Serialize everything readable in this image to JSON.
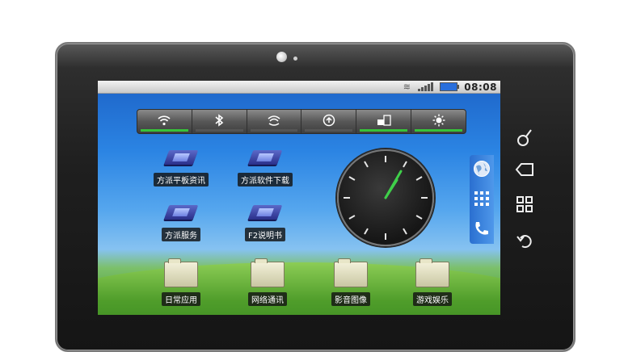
{
  "statusbar": {
    "time": "08:08",
    "wifi_icon": "wifi-icon",
    "signal_icon": "signal-icon",
    "battery_icon": "battery-icon"
  },
  "widget_bar": {
    "toggles": [
      {
        "name": "wifi-toggle",
        "icon": "wifi-icon",
        "glyph": "⌔",
        "on": true
      },
      {
        "name": "bluetooth-toggle",
        "icon": "bluetooth-icon",
        "glyph": "ᛒ",
        "on": false
      },
      {
        "name": "gps-toggle",
        "icon": "gps-icon",
        "glyph": "◠",
        "on": false
      },
      {
        "name": "sync-toggle",
        "icon": "sync-icon",
        "glyph": "⟳",
        "on": false
      },
      {
        "name": "rotate-toggle",
        "icon": "screen-rotate-icon",
        "glyph": "◰",
        "on": true
      },
      {
        "name": "brightness-toggle",
        "icon": "brightness-icon",
        "glyph": "☀",
        "on": true
      }
    ]
  },
  "apps": {
    "fangpai_tablet_news": "方派平板资讯",
    "fangpai_software_download": "方派软件下载",
    "fangpai_service": "方派服务",
    "f2_manual": "F2说明书"
  },
  "folders": {
    "daily_apps": "日常应用",
    "network": "网络通讯",
    "media": "影音图像",
    "games": "游戏娱乐"
  },
  "clock": {
    "hour": 1,
    "minute": 5
  },
  "dock": {
    "browser_icon": "globe-icon",
    "apps_icon": "app-grid-icon",
    "phone_icon": "phone-icon"
  },
  "hardware_buttons": {
    "search": "search-icon",
    "back": "back-icon",
    "menu": "menu-icon",
    "return": "return-icon"
  },
  "colors": {
    "toggle_on": "#38c23a",
    "dock": "#2a6fd0",
    "clock_hand": "#3fcf4a"
  }
}
